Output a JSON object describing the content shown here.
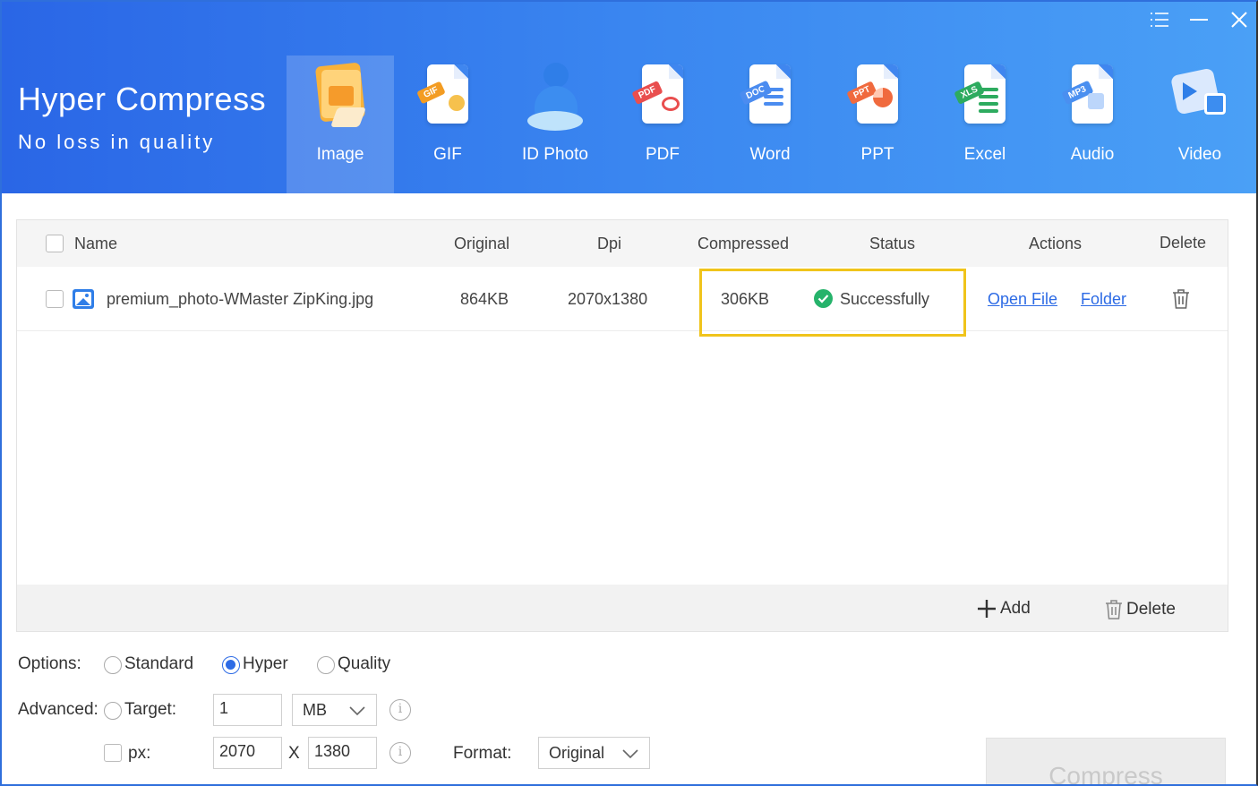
{
  "brand": {
    "title": "Hyper Compress",
    "subtitle": "No loss in quality"
  },
  "window_controls": {
    "menu": "menu-icon",
    "minimize": "minimize-icon",
    "close": "close-icon"
  },
  "nav": [
    {
      "label": "Image",
      "active": true
    },
    {
      "label": "GIF"
    },
    {
      "label": "ID Photo"
    },
    {
      "label": "PDF"
    },
    {
      "label": "Word"
    },
    {
      "label": "PPT"
    },
    {
      "label": "Excel"
    },
    {
      "label": "Audio"
    },
    {
      "label": "Video"
    }
  ],
  "table": {
    "headers": {
      "name": "Name",
      "original": "Original",
      "dpi": "Dpi",
      "compressed": "Compressed",
      "status": "Status",
      "actions": "Actions",
      "delete": "Delete"
    },
    "rows": [
      {
        "name": "premium_photo-WMaster ZipKing.jpg",
        "original": "864KB",
        "dpi": "2070x1380",
        "compressed": "306KB",
        "status": "Successfully",
        "open_file": "Open File",
        "folder": "Folder"
      }
    ],
    "footer": {
      "add": "Add",
      "delete": "Delete"
    }
  },
  "options": {
    "label": "Options:",
    "modes": [
      "Standard",
      "Hyper",
      "Quality"
    ],
    "selected": "Hyper"
  },
  "advanced": {
    "label": "Advanced:",
    "target_label": "Target:",
    "target_value": "1",
    "target_unit": "MB",
    "px_label": "px:",
    "width": "2070",
    "x_sep": "X",
    "height": "1380",
    "format_label": "Format:",
    "format_value": "Original"
  },
  "compress_button": "Compress",
  "colors": {
    "header_start": "#2a66e6",
    "header_end": "#4aa0f6",
    "link": "#2d6be5",
    "highlight": "#f0c41b",
    "success": "#26b36b"
  }
}
